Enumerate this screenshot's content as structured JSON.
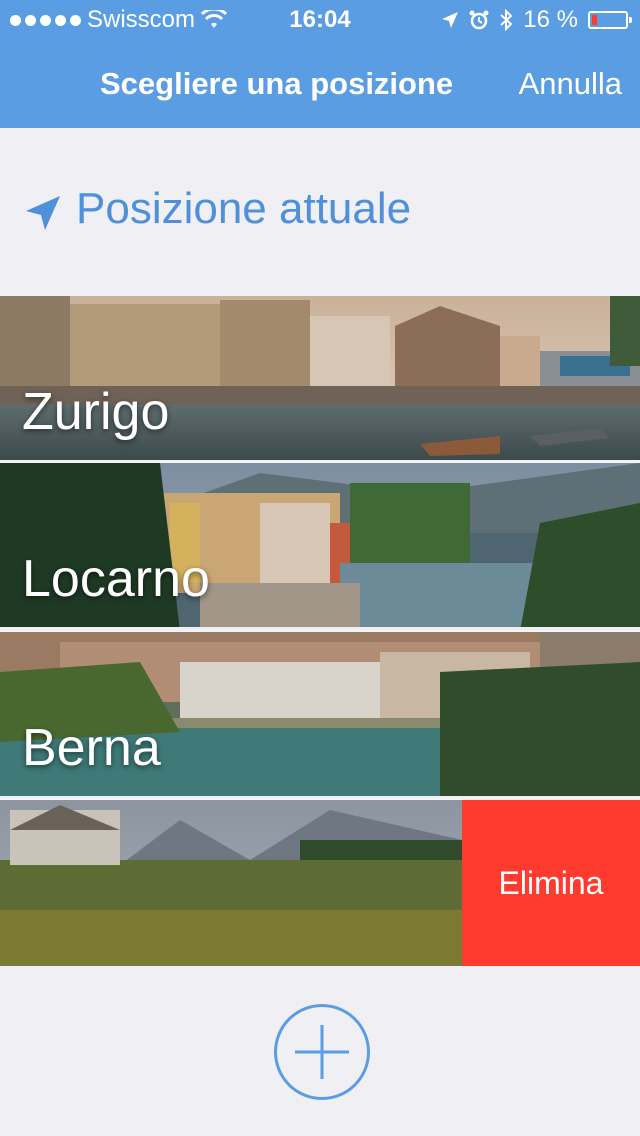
{
  "status": {
    "carrier": "Swisscom",
    "time": "16:04",
    "battery_pct": "16 %",
    "battery_level": 0.16
  },
  "header": {
    "title": "Scegliere una posizione",
    "cancel_label": "Annulla"
  },
  "current_location": {
    "label": "Posizione attuale"
  },
  "locations": [
    {
      "name": "Zurigo"
    },
    {
      "name": "Locarno"
    },
    {
      "name": "Berna"
    },
    {
      "name": ""
    }
  ],
  "delete_label": "Elimina",
  "colors": {
    "accent": "#5b9de3",
    "delete": "#ff3b30",
    "background": "#efeff4"
  }
}
